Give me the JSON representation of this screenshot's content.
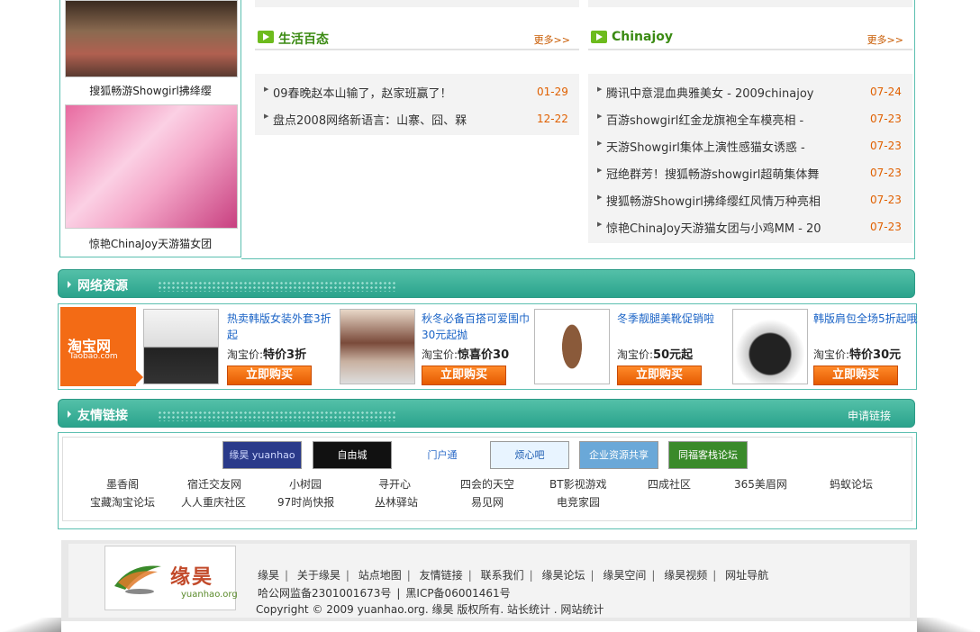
{
  "photos": [
    {
      "caption": "搜狐畅游Showgirl拂绛缨"
    },
    {
      "caption": "惊艳ChinaJoy天游猫女团"
    }
  ],
  "life": {
    "title": "生活百态",
    "more": "更多>>",
    "items": [
      {
        "text": "09春晚赵本山输了，赵家班赢了！",
        "date": "01-29"
      },
      {
        "text": "盘点2008网络新语言：山寨、囧、槑",
        "date": "12-22"
      }
    ]
  },
  "chinajoy": {
    "title": "Chinajoy",
    "more": "更多>>",
    "items": [
      {
        "text": "腾讯中意混血典雅美女 - 2009chinajoy",
        "date": "07-24"
      },
      {
        "text": "百游showgirl红金龙旗袍全车模亮相 -",
        "date": "07-23"
      },
      {
        "text": "天游Showgirl集体上演性感猫女诱惑 -",
        "date": "07-23"
      },
      {
        "text": "冠绝群芳！搜狐畅游showgirl超萌集体舞",
        "date": "07-23"
      },
      {
        "text": "搜狐畅游Showgirl拂绛缨红风情万种亮相",
        "date": "07-23"
      },
      {
        "text": "惊艳ChinaJoy天游猫女团与小鸡MM - 20",
        "date": "07-23"
      }
    ]
  },
  "resources": {
    "title": "网络资源"
  },
  "taobao": {
    "logo_cn": "淘宝网",
    "logo_en": "Taobao.com",
    "price_label": "淘宝价:",
    "buy_label": "立即购买",
    "items": [
      {
        "title": "热卖韩版女装外套3折起",
        "price": "特价3折"
      },
      {
        "title": "秋冬必备百搭可爱围巾30元起抛",
        "price": "惊喜价30"
      },
      {
        "title": "冬季靓腿美靴促销啦",
        "price": "50元起"
      },
      {
        "title": "韩版肩包全场5折起哦",
        "price": "特价30元"
      }
    ]
  },
  "links": {
    "title": "友情链接",
    "apply": "申请链接",
    "logos": [
      "缘昊 yuanhao",
      "自由城 www.zyc9.com",
      "门户通 menhutong.com.cn",
      "烦心吧 FANXIN8.COM",
      "企业资源共享",
      "同福客栈论坛"
    ],
    "row1": [
      "墨香阁",
      "宿迁交友网",
      "小树园",
      "寻开心",
      "四会的天空",
      "BT影视游戏",
      "四成社区",
      "365美眉网",
      "蚂蚁论坛"
    ],
    "row2": [
      "宝藏淘宝论坛",
      "人人重庆社区",
      "97时尚快报",
      "丛林驿站",
      "易见网",
      "电竞家园"
    ]
  },
  "footer": {
    "logo_cn": "缘昊",
    "logo_en": "yuanhao.org",
    "nav": [
      "缘昊",
      "关于缘昊",
      "站点地图",
      "友情链接",
      "联系我们",
      "缘昊论坛",
      "缘昊空间",
      "缘昊视频",
      "网址导航"
    ],
    "icp1": "哈公网监备2301001673号",
    "icp2": "黑ICP备06001461号",
    "copyright": "Copyright © 2009 yuanhao.org. 缘昊 版权所有. 站长统计 . 网站统计"
  },
  "colors": {
    "teal": "#2aa38c",
    "orange": "#e06000",
    "green": "#3a8a12",
    "link_blue": "#1a63c6"
  }
}
